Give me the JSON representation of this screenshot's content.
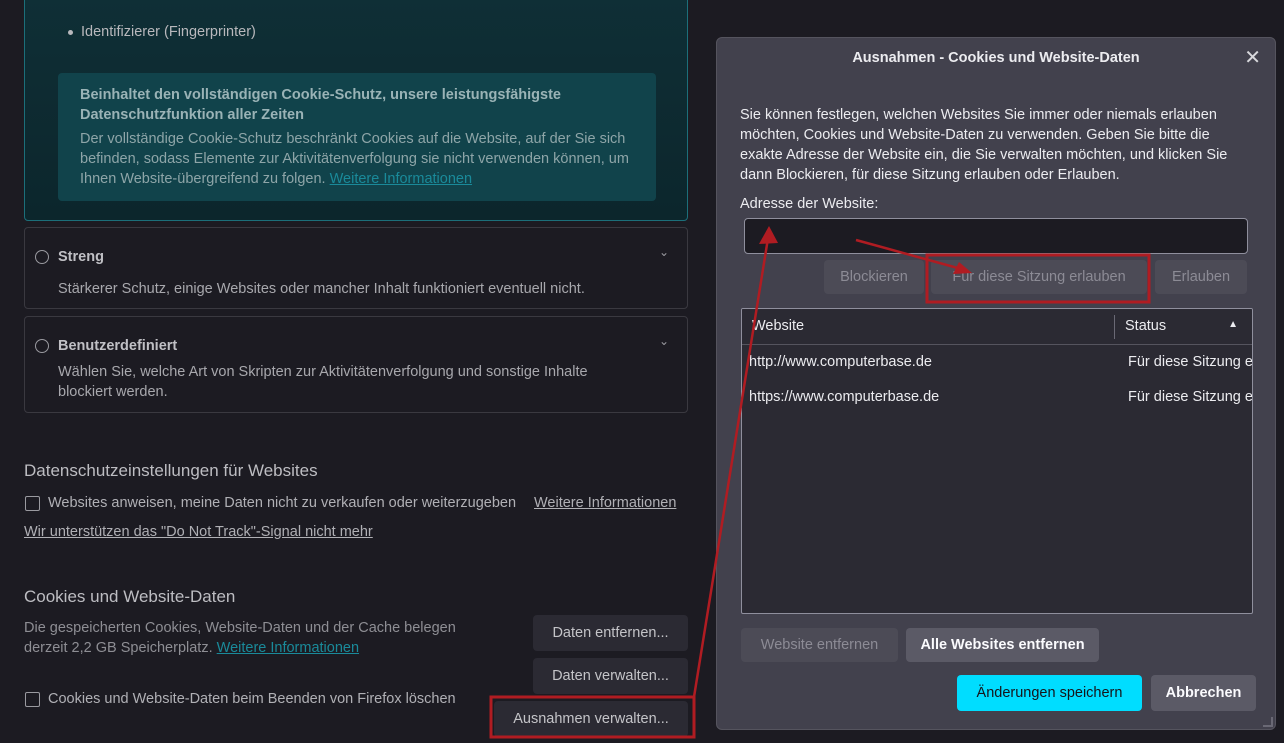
{
  "tracking": {
    "bullet": "Identifizierer (Fingerprinter)",
    "info_head": "Beinhaltet den vollständigen Cookie-Schutz, unsere leistungsfähigste Datenschutzfunktion aller Zeiten",
    "info_body": "Der vollständige Cookie-Schutz beschränkt Cookies auf die Website, auf der Sie sich befinden, sodass Elemente zur Aktivitätenverfolgung sie nicht verwenden können, um Ihnen Website-übergreifend zu folgen.",
    "info_link": "Weitere Informationen",
    "strict_title": "Streng",
    "strict_desc": "Stärkerer Schutz, einige Websites oder mancher Inhalt funktioniert eventuell nicht.",
    "custom_title": "Benutzerdefiniert",
    "custom_desc": "Wählen Sie, welche Art von Skripten zur Aktivitätenverfolgung und sonstige Inhalte blockiert werden."
  },
  "privacy": {
    "heading": "Datenschutzeinstellungen für Websites",
    "dont_sell": "Websites anweisen, meine Daten nicht zu verkaufen oder weiterzugeben",
    "more_info": "Weitere Informationen",
    "dnt_link": "Wir unterstützen das \"Do Not Track\"-Signal nicht mehr"
  },
  "cookies": {
    "heading": "Cookies und Website-Daten",
    "desc": "Die gespeicherten Cookies, Website-Daten und der Cache belegen derzeit 2,2 GB Speicherplatz.",
    "more_info": "Weitere Informationen",
    "clear_btn": "Daten entfernen...",
    "manage_btn": "Daten verwalten...",
    "delete_on_close": "Cookies und Website-Daten beim Beenden von Firefox löschen",
    "exceptions_btn": "Ausnahmen verwalten..."
  },
  "dialog": {
    "title": "Ausnahmen - Cookies und Website-Daten",
    "description": "Sie können festlegen, welchen Websites Sie immer oder niemals erlauben möchten, Cookies und Website-Daten zu verwenden. Geben Sie bitte die exakte Adresse der Website ein, die Sie verwalten möchten, und klicken Sie dann Blockieren, für diese Sitzung erlauben oder Erlauben.",
    "address_label": "Adresse der Website:",
    "address_value": "",
    "block_btn": "Blockieren",
    "session_btn": "Für diese Sitzung erlauben",
    "allow_btn": "Erlauben",
    "columns": [
      "Website",
      "Status"
    ],
    "rows": [
      {
        "website": "http://www.computerbase.de",
        "status": "Für diese Sitzung erlauben"
      },
      {
        "website": "https://www.computerbase.de",
        "status": "Für diese Sitzung erlauben"
      }
    ],
    "remove_btn": "Website entfernen",
    "remove_all_btn": "Alle Websites entfernen",
    "save_btn": "Änderungen speichern",
    "cancel_btn": "Abbrechen"
  },
  "colors": {
    "accent": "#00ddff",
    "annotation": "#b01c22",
    "link": "#1a8a9a"
  }
}
